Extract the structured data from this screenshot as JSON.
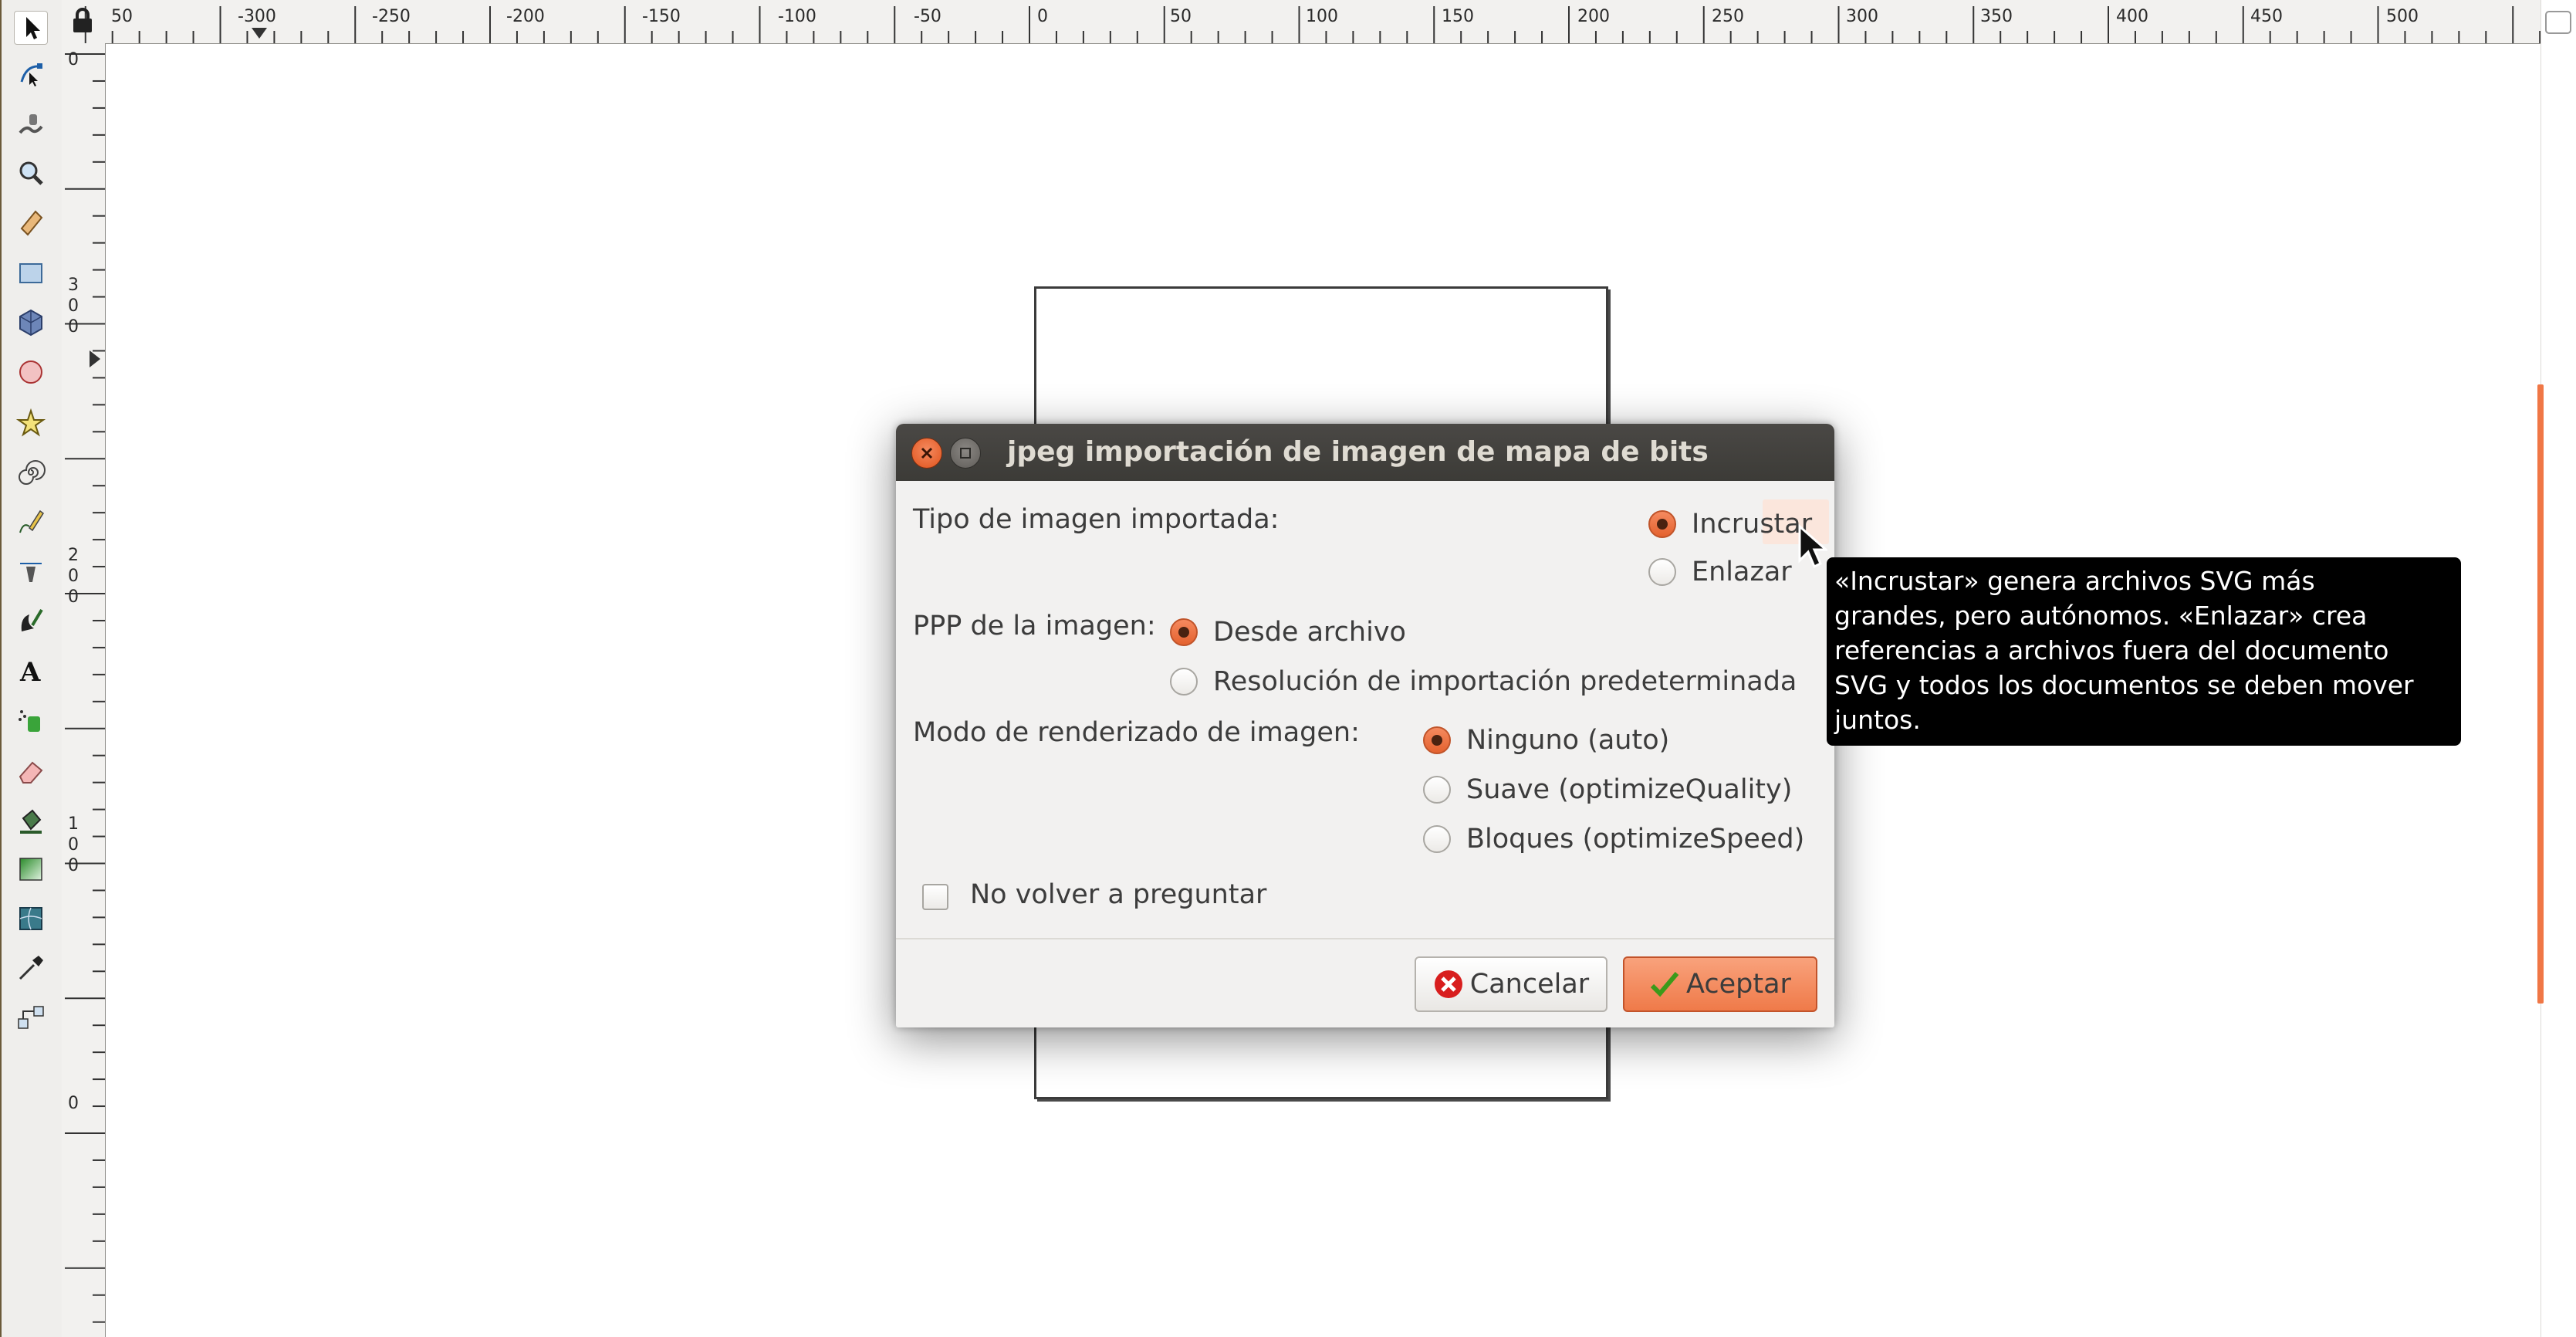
{
  "toolbox": {
    "tools": [
      {
        "name": "selector-tool",
        "icon": "arrow-pointer-icon",
        "active": true
      },
      {
        "name": "node-tool",
        "icon": "node-edit-icon"
      },
      {
        "name": "tweak-tool",
        "icon": "tweak-icon"
      },
      {
        "name": "zoom-tool",
        "icon": "magnifier-icon"
      },
      {
        "name": "measure-tool",
        "icon": "ruler-icon"
      },
      {
        "name": "rect-tool",
        "icon": "rectangle-icon"
      },
      {
        "name": "3dbox-tool",
        "icon": "3d-box-icon"
      },
      {
        "name": "ellipse-tool",
        "icon": "circle-icon"
      },
      {
        "name": "star-tool",
        "icon": "star-icon"
      },
      {
        "name": "spiral-tool",
        "icon": "spiral-icon"
      },
      {
        "name": "pencil-tool",
        "icon": "pencil-icon"
      },
      {
        "name": "pen-tool",
        "icon": "pen-bezier-icon"
      },
      {
        "name": "calligraphy-tool",
        "icon": "calligraphy-icon"
      },
      {
        "name": "text-tool",
        "icon": "text-a-icon"
      },
      {
        "name": "spray-tool",
        "icon": "spray-icon"
      },
      {
        "name": "eraser-tool",
        "icon": "eraser-icon"
      },
      {
        "name": "paint-bucket-tool",
        "icon": "paint-bucket-icon"
      },
      {
        "name": "gradient-tool",
        "icon": "gradient-icon"
      },
      {
        "name": "mesh-tool",
        "icon": "mesh-icon"
      },
      {
        "name": "dropper-tool",
        "icon": "dropper-icon"
      },
      {
        "name": "connector-tool",
        "icon": "connector-icon"
      }
    ]
  },
  "ruler_top": {
    "labels": [
      "50",
      "-300",
      "-250",
      "-200",
      "-150",
      "-100",
      "-50",
      "0",
      "50",
      "100",
      "150",
      "200",
      "250",
      "300",
      "350",
      "400",
      "450",
      "500"
    ]
  },
  "ruler_left": {
    "labels": [
      "0",
      "300",
      "200",
      "100",
      "0"
    ]
  },
  "dialog": {
    "title": "jpeg importación de imagen de mapa de bits",
    "image_type_label": "Tipo de imagen importada:",
    "image_type_options": [
      "Incrustar",
      "Enlazar"
    ],
    "image_type_selected": "Incrustar",
    "dpi_label": "PPP de la imagen:",
    "dpi_options": [
      "Desde archivo",
      "Resolución de importación predeterminada"
    ],
    "dpi_selected": "Desde archivo",
    "render_mode_label": "Modo de renderizado de imagen:",
    "render_mode_options": [
      "Ninguno (auto)",
      "Suave (optimizeQuality)",
      "Bloques (optimizeSpeed)"
    ],
    "render_mode_selected": "Ninguno (auto)",
    "dont_ask_label": "No volver a preguntar",
    "dont_ask_checked": false,
    "cancel_label": "Cancelar",
    "ok_label": "Aceptar"
  },
  "tooltip": {
    "lines": [
      "«Incrustar» genera archivos SVG más",
      "grandes, pero autónomos. «Enlazar» crea",
      "referencias a archivos fuera del documento",
      "SVG y todos los documentos se deben mover",
      "juntos."
    ]
  },
  "colors": {
    "accent": "#ef7a49",
    "titlebar": "#3c3b37",
    "dialog_bg": "#f2f1f0",
    "tooltip_bg": "#000000"
  }
}
